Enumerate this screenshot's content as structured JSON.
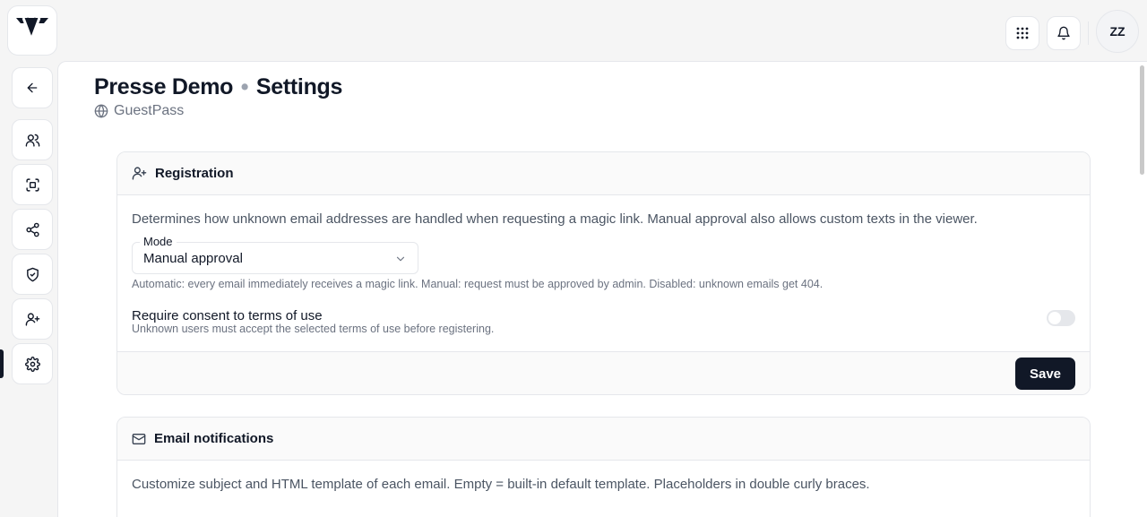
{
  "header": {
    "logo_icon": "brand-logo",
    "apps_icon": "grid-dots-icon",
    "bell_icon": "bell-icon",
    "avatar_initials": "ZZ"
  },
  "sidebar": {
    "items": [
      {
        "name": "back",
        "icon": "arrow-left-icon"
      },
      {
        "name": "users",
        "icon": "users-icon"
      },
      {
        "name": "scan",
        "icon": "scan-face-icon"
      },
      {
        "name": "share",
        "icon": "share-icon"
      },
      {
        "name": "security",
        "icon": "shield-check-icon"
      },
      {
        "name": "add-user",
        "icon": "user-plus-icon"
      },
      {
        "name": "settings",
        "icon": "gear-icon",
        "active": true
      }
    ]
  },
  "page": {
    "title_main": "Presse Demo",
    "title_sep": "•",
    "title_section": "Settings",
    "subtitle": "GuestPass"
  },
  "registration": {
    "title": "Registration",
    "description": "Determines how unknown email addresses are handled when requesting a magic link. Manual approval also allows custom texts in the viewer.",
    "mode_label": "Mode",
    "mode_value": "Manual approval",
    "helper": "Automatic: every email immediately receives a magic link. Manual: request must be approved by admin. Disabled: unknown emails get 404.",
    "consent_title": "Require consent to terms of use",
    "consent_sub": "Unknown users must accept the selected terms of use before registering.",
    "consent_enabled": false,
    "save_label": "Save"
  },
  "email": {
    "title": "Email notifications",
    "description": "Customize subject and HTML template of each email. Empty = built-in default template. Placeholders in double curly braces."
  },
  "colors": {
    "primary": "#111827",
    "background": "#f5f5f5",
    "border": "#e5e7eb"
  }
}
